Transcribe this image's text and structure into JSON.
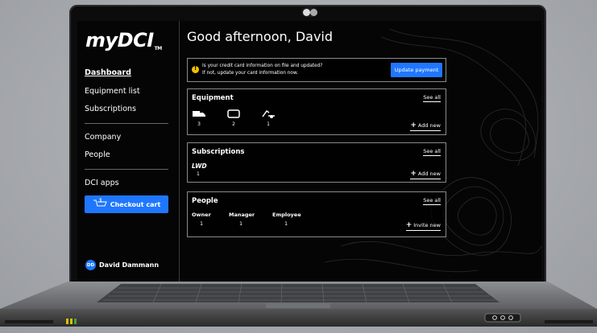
{
  "app": {
    "logo": "myDCI",
    "logo_tm": "TM"
  },
  "sidebar": {
    "items": [
      {
        "label": "Dashboard",
        "active": true
      },
      {
        "label": "Equipment list"
      },
      {
        "label": "Subscriptions"
      },
      {
        "label": "Company"
      },
      {
        "label": "People"
      },
      {
        "label": "DCI apps"
      }
    ],
    "checkout_label": "Checkout cart",
    "cart_count": "1",
    "user": {
      "initials": "DD",
      "name": "David Dammann"
    }
  },
  "main": {
    "greeting": "Good afternoon, David",
    "alert": {
      "line1": "Is your credit card information on file and updated?",
      "line2": "If not, update your card information now.",
      "button": "Update payment"
    },
    "equipment": {
      "title": "Equipment",
      "see_all": "See all",
      "add_new": "Add new",
      "items": [
        {
          "icon": "truck-icon",
          "count": "3"
        },
        {
          "icon": "trailer-icon",
          "count": "2"
        },
        {
          "icon": "excavator-icon",
          "count": "1"
        }
      ]
    },
    "subscriptions": {
      "title": "Subscriptions",
      "see_all": "See all",
      "add_new": "Add new",
      "item": {
        "label": "LWD",
        "count": "1"
      }
    },
    "people": {
      "title": "People",
      "see_all": "See all",
      "invite": "Invite new",
      "roles": [
        {
          "label": "Owner",
          "count": "1"
        },
        {
          "label": "Manager",
          "count": "1"
        },
        {
          "label": "Employee",
          "count": "1"
        }
      ]
    }
  },
  "colors": {
    "accent": "#1f77ff",
    "warning": "#f6c000",
    "background": "#050505"
  }
}
